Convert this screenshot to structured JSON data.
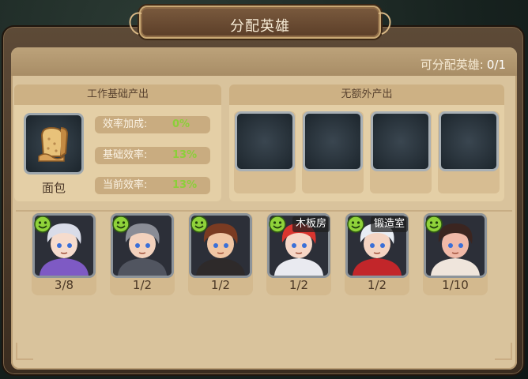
{
  "title": "分配英雄",
  "assignable": {
    "label": "可分配英雄:",
    "value": "0/1"
  },
  "left_panel": {
    "header": "工作基础产出",
    "item_name": "面包",
    "item_icon": "bread-icon",
    "stats": [
      {
        "label": "效率加成:",
        "value": "0%"
      },
      {
        "label": "基础效率:",
        "value": "13%"
      },
      {
        "label": "当前效率:",
        "value": "13%"
      }
    ]
  },
  "right_panel": {
    "header": "无额外产出",
    "slot_count": 4
  },
  "heroes": [
    {
      "count": "3/8",
      "tag": "",
      "hair": "#d9dce8",
      "skin": "#f6dccd",
      "outfit": "#7e5ac4"
    },
    {
      "count": "1/2",
      "tag": "",
      "hair": "#8a8d96",
      "skin": "#f3d2bd",
      "outfit": "#515560"
    },
    {
      "count": "1/2",
      "tag": "",
      "hair": "#7a3b22",
      "skin": "#f0c6a4",
      "outfit": "#2e2a2a"
    },
    {
      "count": "1/2",
      "tag": "木板房",
      "hair": "#d9352f",
      "skin": "#f6d6c6",
      "outfit": "#e9eaf0"
    },
    {
      "count": "1/2",
      "tag": "锻造室",
      "hair": "#e8edf4",
      "skin": "#f4d4c2",
      "outfit": "#c2262a"
    },
    {
      "count": "1/10",
      "tag": "",
      "hair": "#3b2520",
      "skin": "#f0b9a8",
      "outfit": "#efe5dc"
    }
  ],
  "colors": {
    "accent_green": "#8ccf3a",
    "parchment": "#d9c39c",
    "frame": "#5d4a37"
  }
}
